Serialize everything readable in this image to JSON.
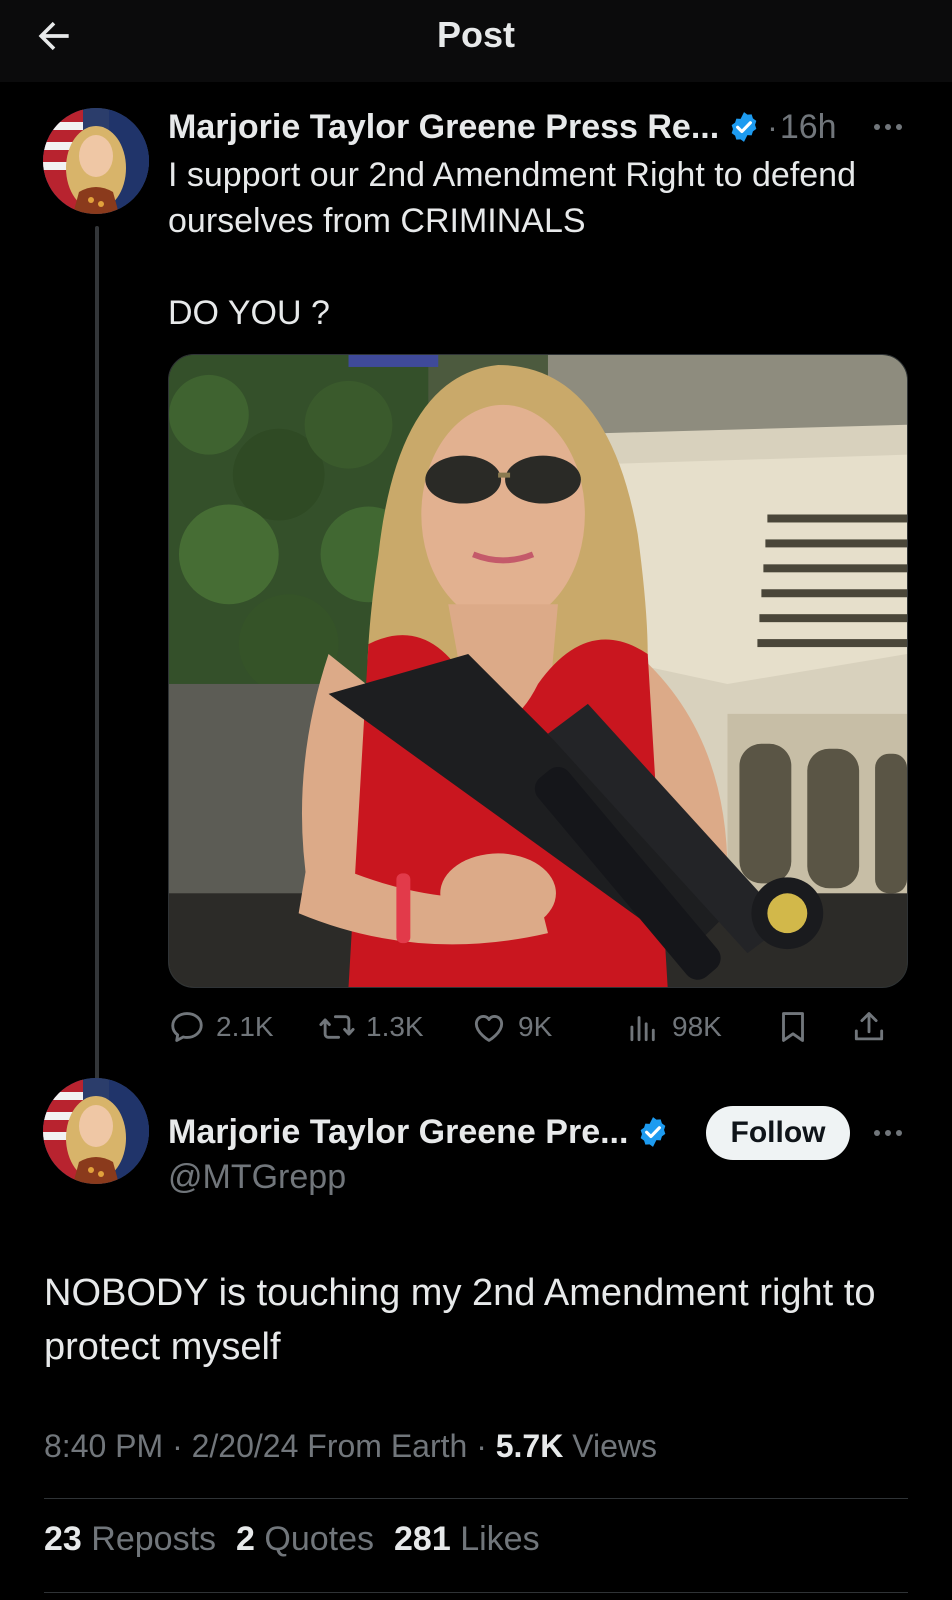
{
  "header": {
    "title": "Post"
  },
  "parent_post": {
    "author": "Marjorie Taylor Greene Press Re...",
    "separator": "·",
    "time": "16h",
    "text_line1": "I support our 2nd Amendment Right to defend ourselves from CRIMINALS",
    "text_line2": "DO YOU ?",
    "actions": {
      "replies": "2.1K",
      "reposts": "1.3K",
      "likes": "9K",
      "views": "98K"
    }
  },
  "main_post": {
    "author": "Marjorie Taylor Greene Pre...",
    "handle": "@MTGrepp",
    "follow_label": "Follow",
    "text": "NOBODY is touching my 2nd Amendment right to protect myself",
    "meta_prefix": "8:40 PM · 2/20/24 From Earth · ",
    "views_count": "5.7K",
    "views_label": " Views",
    "stats": [
      {
        "count": "23",
        "label": "Reposts"
      },
      {
        "count": "2",
        "label": "Quotes"
      },
      {
        "count": "281",
        "label": "Likes"
      }
    ]
  },
  "colors": {
    "background": "#000000",
    "text": "#e7e9ea",
    "muted": "#71767b",
    "verified": "#1d9bf0",
    "follow_bg": "#eff3f4"
  },
  "icons": [
    "back-arrow-icon",
    "verified-badge-icon",
    "more-icon",
    "reply-icon",
    "repost-icon",
    "like-icon",
    "views-icon",
    "bookmark-icon",
    "share-icon"
  ]
}
